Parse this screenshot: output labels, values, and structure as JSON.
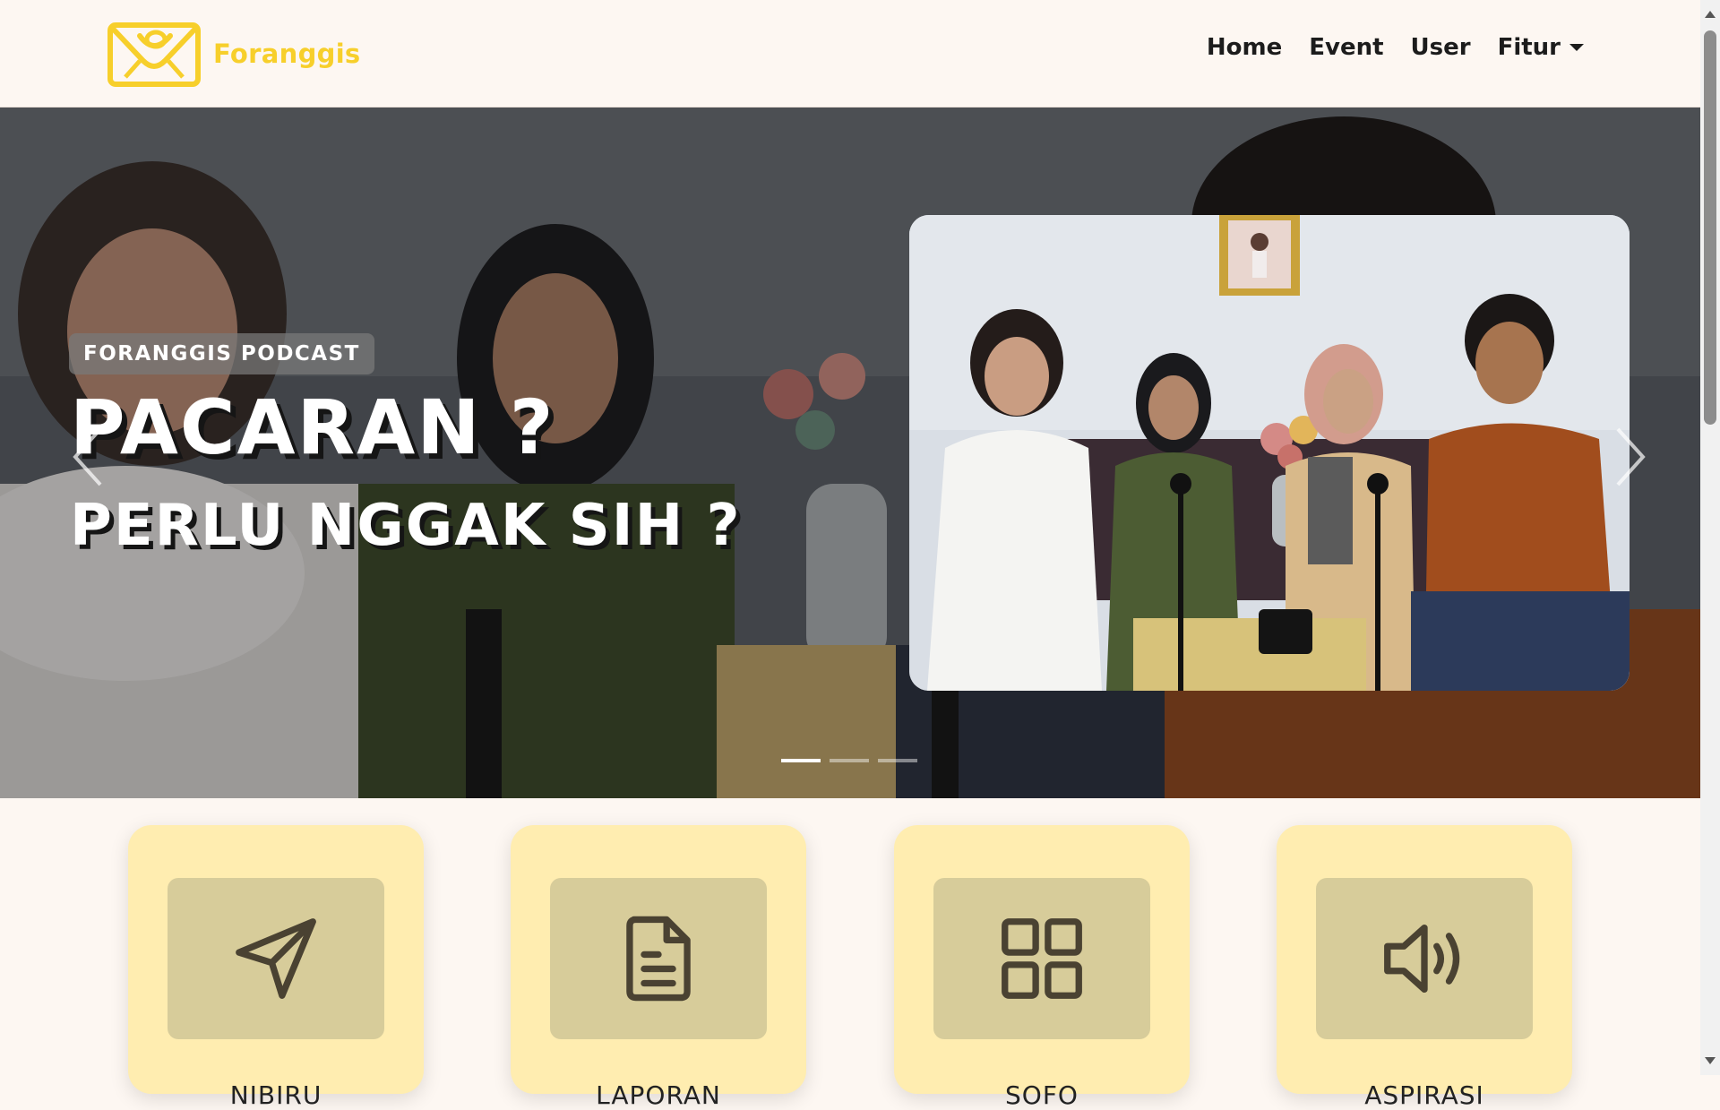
{
  "brand": {
    "name": "Foranggis",
    "logo_icon": "envelope-face-logo",
    "color": "#f7cf2b"
  },
  "nav": {
    "items": [
      {
        "label": "Home"
      },
      {
        "label": "Event"
      },
      {
        "label": "User"
      },
      {
        "label": "Fitur",
        "has_dropdown": true
      }
    ]
  },
  "hero": {
    "badge": "FORANGGIS PODCAST",
    "title": "PACARAN ?",
    "subtitle": "PERLU NGGAK SIH ?",
    "slide_count": 3,
    "active_slide": 1
  },
  "features": [
    {
      "label": "NIBIRU",
      "icon": "paper-plane-icon"
    },
    {
      "label": "LAPORAN",
      "icon": "document-icon"
    },
    {
      "label": "SOFO",
      "icon": "grid-icon"
    },
    {
      "label": "ASPIRASI",
      "icon": "speaker-icon"
    }
  ],
  "colors": {
    "page_bg": "#fdf7f2",
    "card_bg": "#ffedb0",
    "icon_box_bg": "#d7cc9a",
    "icon_stroke": "#4a4232"
  }
}
